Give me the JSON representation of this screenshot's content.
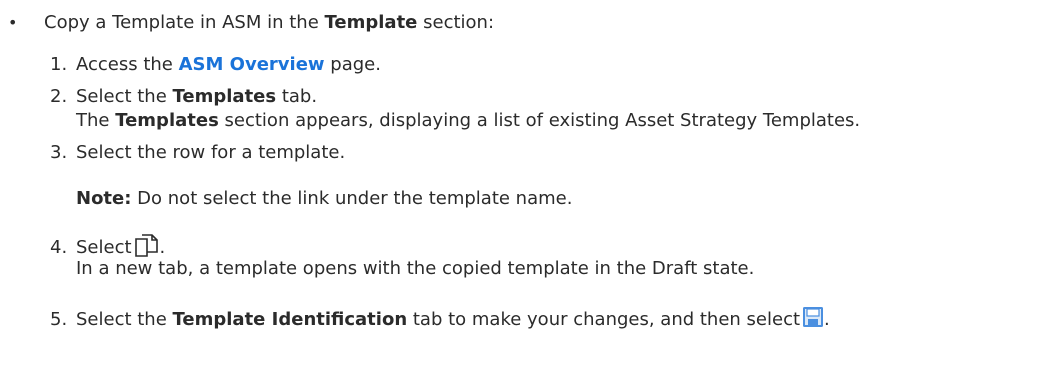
{
  "bullet": {
    "marker": "•",
    "pre": "Copy a Template in ASM in the ",
    "bold": "Template",
    "post": " section:"
  },
  "steps": [
    {
      "num": "1.",
      "pre": "Access the ",
      "link": "ASM Overview",
      "post": " page."
    },
    {
      "num": "2.",
      "pre": "Select the ",
      "bold": "Templates",
      "post": " tab."
    },
    {
      "sub_bold": "Templates",
      "sub_pre": "The ",
      "sub_post": " section appears, displaying a list of existing Asset Strategy Templates."
    },
    {
      "num": "3.",
      "text": "Select the row for a template."
    },
    {
      "note_label": "Note:",
      "note_text": " Do not select the link under the template name."
    },
    {
      "num": "4.",
      "pre": "Select",
      "icon": "copy-icon",
      "post": "."
    },
    {
      "sub_text": "In a new tab, a template opens with the copied template in the Draft state."
    },
    {
      "num": "5.",
      "pre": "Select the ",
      "bold": "Template Identification",
      "post": " tab to make your changes, and then select",
      "icon": "save-icon",
      "post2": "."
    }
  ],
  "colors": {
    "text": "#2b2b2b",
    "link": "#1a73d9",
    "save_icon": "#4a8fe0"
  }
}
